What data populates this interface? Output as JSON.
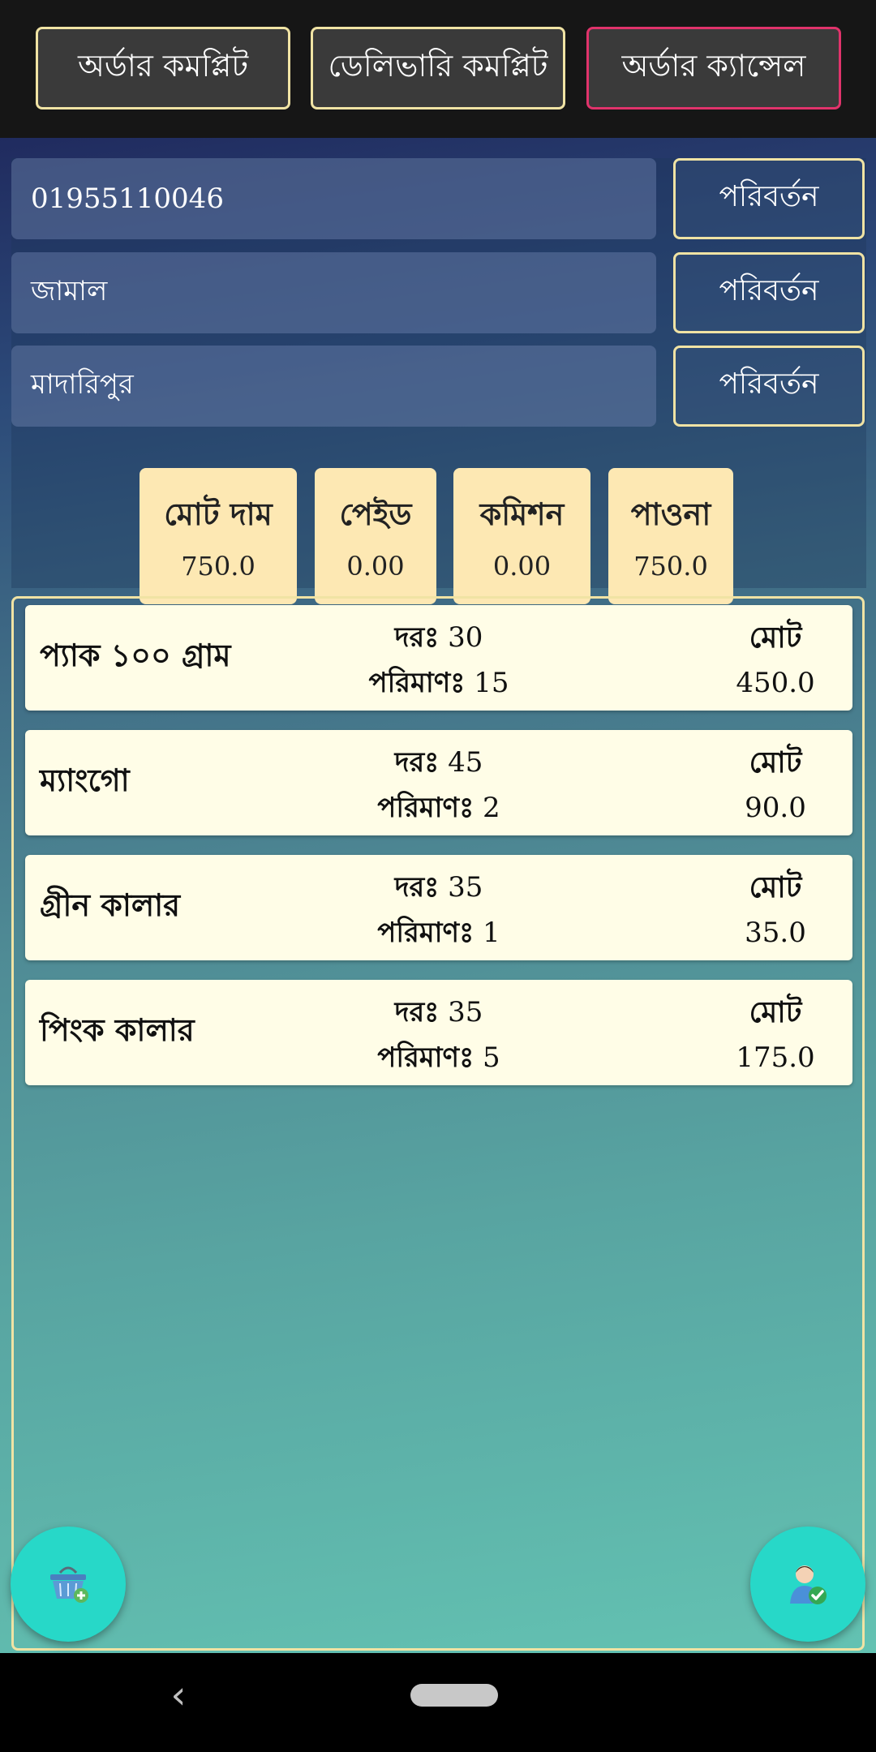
{
  "top_actions": {
    "order_complete": "অর্ডার কমপ্লিট",
    "delivery_complete": "ডেলিভারি কমপ্লিট",
    "order_cancel": "অর্ডার ক্যান্সেল"
  },
  "customer": {
    "phone": "01955110046",
    "name": "জামাল",
    "address": "মাদারিপুর",
    "change_label": "পরিবর্তন"
  },
  "summary": {
    "total_price_label": "মোট দাম",
    "total_price": "750.0",
    "paid_label": "পেইড",
    "paid": "0.00",
    "commission_label": "কমিশন",
    "commission": "0.00",
    "due_label": "পাওনা",
    "due": "750.0"
  },
  "item_labels": {
    "rate": "দরঃ",
    "quantity": "পরিমাণঃ",
    "total": "মোট"
  },
  "items": [
    {
      "name": "প্যাক ১০০ গ্রাম",
      "rate": "30",
      "quantity": "15",
      "total": "450.0"
    },
    {
      "name": "ম্যাংগো",
      "rate": "45",
      "quantity": "2",
      "total": "90.0"
    },
    {
      "name": "গ্রীন কালার",
      "rate": "35",
      "quantity": "1",
      "total": "35.0"
    },
    {
      "name": "পিংক কালার",
      "rate": "35",
      "quantity": "5",
      "total": "175.0"
    }
  ],
  "icons": {
    "add_to_basket": "basket-add-icon",
    "customer_confirm": "user-check-icon",
    "back": "back-chevron-icon"
  },
  "colors": {
    "accent_border": "#f0e3a4",
    "cancel_border": "#e0336b",
    "card_bg": "#fde8b3",
    "fab": "#27d8c8"
  }
}
